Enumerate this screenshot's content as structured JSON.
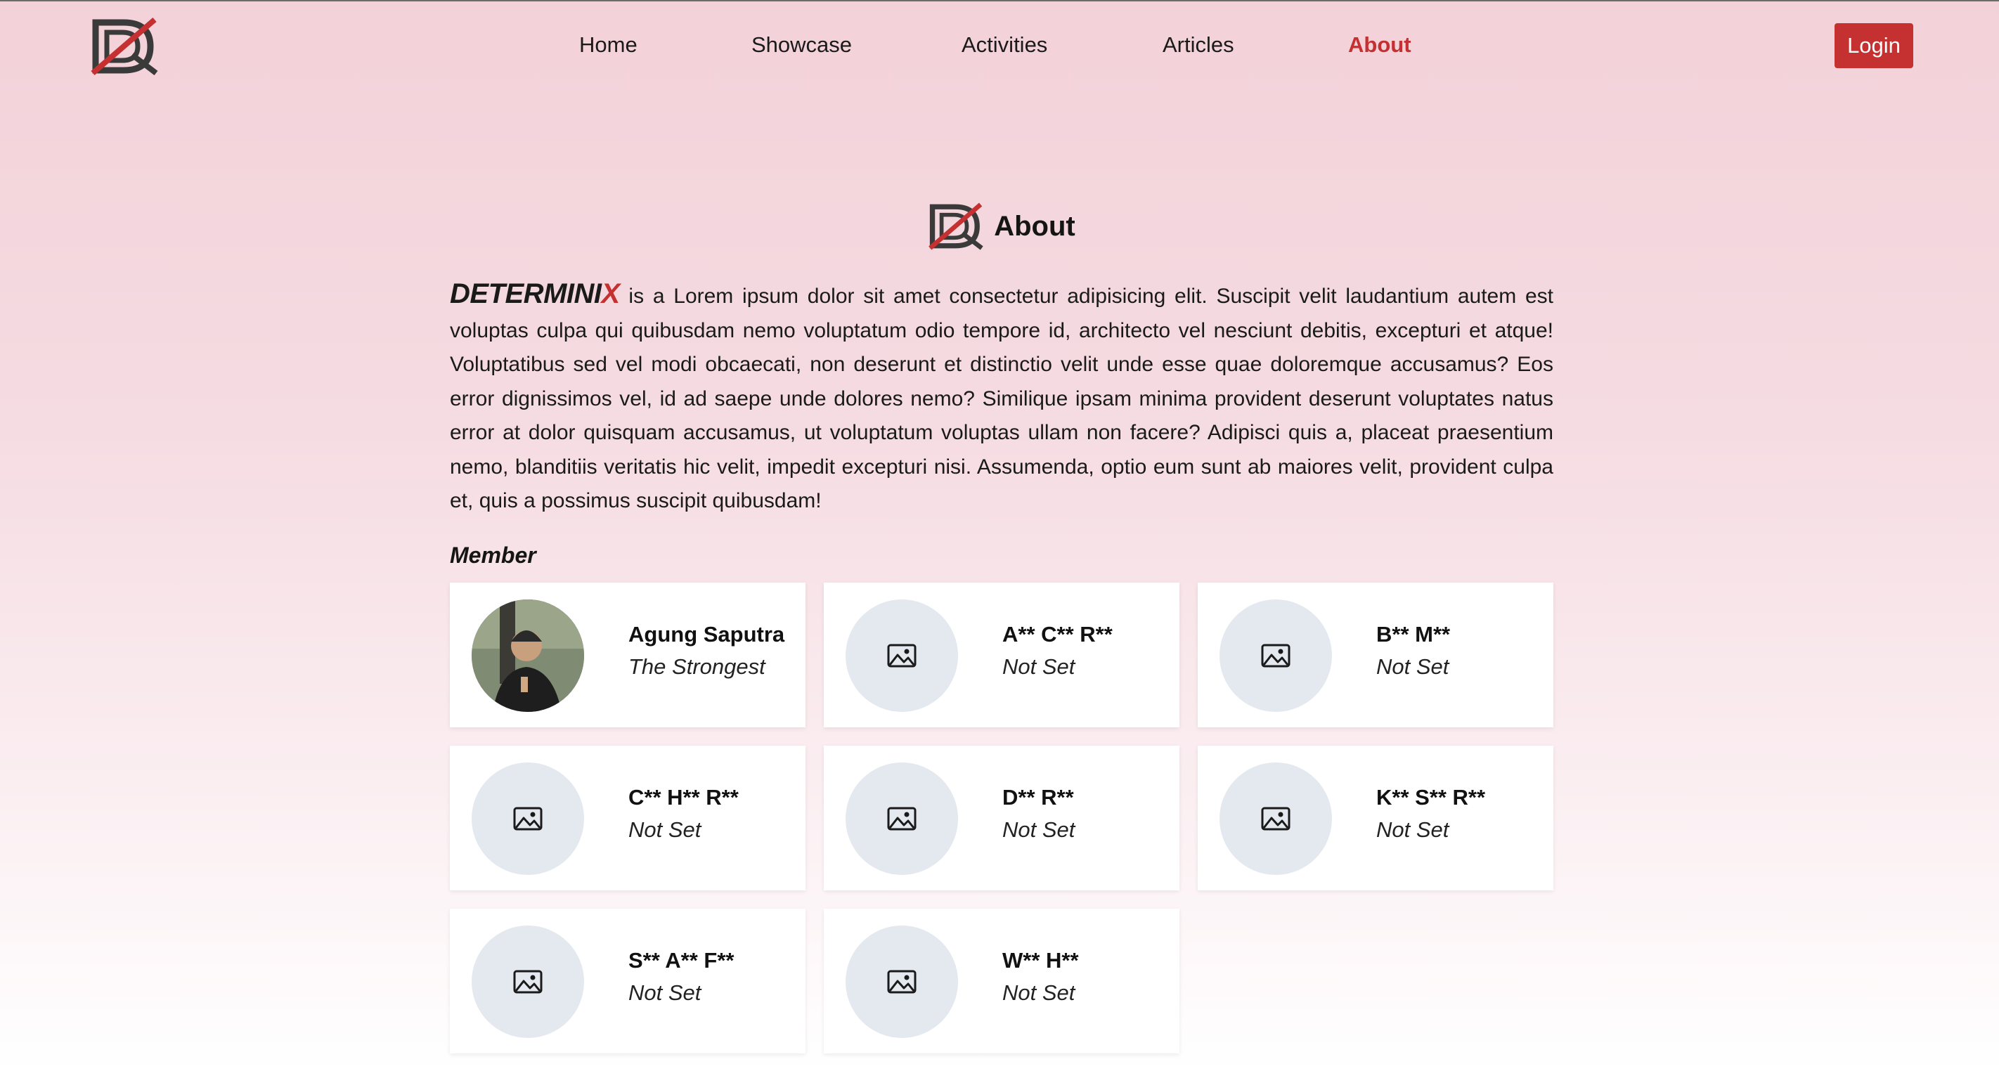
{
  "nav": {
    "items": [
      {
        "label": "Home",
        "active": false
      },
      {
        "label": "Showcase",
        "active": false
      },
      {
        "label": "Activities",
        "active": false
      },
      {
        "label": "Articles",
        "active": false
      },
      {
        "label": "About",
        "active": true
      }
    ],
    "login_label": "Login"
  },
  "about": {
    "title": "About",
    "brand_main": "DETERMINI",
    "brand_accent": "X",
    "description": " is a Lorem ipsum dolor sit amet consectetur adipisicing elit. Suscipit velit laudantium autem est voluptas culpa qui quibusdam nemo voluptatum odio tempore id, architecto vel nesciunt debitis, excepturi et atque! Voluptatibus sed vel modi obcaecati, non deserunt et distinctio velit unde esse quae doloremque accusamus? Eos error dignissimos vel, id ad saepe unde dolores nemo? Similique ipsam minima provident deserunt voluptates natus error at dolor quisquam accusamus, ut voluptatum voluptas ullam non facere? Adipisci quis a, placeat praesentium nemo, blanditiis veritatis hic velit, impedit excepturi nisi. Assumenda, optio eum sunt ab maiores velit, provident culpa et, quis a possimus suscipit quibusdam!"
  },
  "members": {
    "heading": "Member",
    "list": [
      {
        "name": "Agung Saputra",
        "role": "The Strongest",
        "has_photo": true
      },
      {
        "name": "A** C** R**",
        "role": "Not Set",
        "has_photo": false
      },
      {
        "name": "B** M**",
        "role": "Not Set",
        "has_photo": false
      },
      {
        "name": "C** H** R**",
        "role": "Not Set",
        "has_photo": false
      },
      {
        "name": "D** R**",
        "role": "Not Set",
        "has_photo": false
      },
      {
        "name": "K** S** R**",
        "role": "Not Set",
        "has_photo": false
      },
      {
        "name": "S** A** F**",
        "role": "Not Set",
        "has_photo": false
      },
      {
        "name": "W** H**",
        "role": "Not Set",
        "has_photo": false
      }
    ]
  },
  "colors": {
    "accent": "#c53030",
    "placeholder_avatar": "#e4e8ef"
  },
  "icons": {
    "logo": "determinix-logo-icon",
    "placeholder": "image-placeholder-icon"
  }
}
